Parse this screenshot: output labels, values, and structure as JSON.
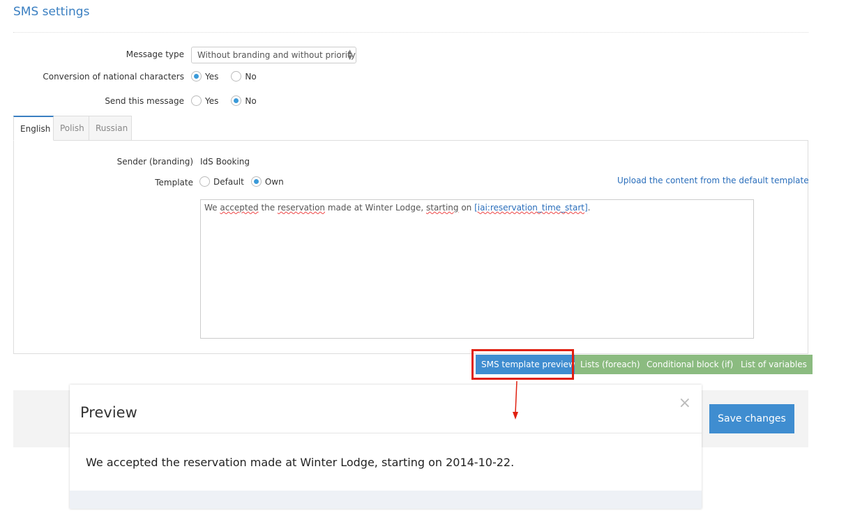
{
  "page": {
    "title": "SMS settings"
  },
  "form": {
    "message_type": {
      "label": "Message type",
      "value": "Without branding and without priority"
    },
    "conversion": {
      "label": "Conversion of national characters",
      "options": [
        "Yes",
        "No"
      ],
      "selected": "Yes"
    },
    "send": {
      "label": "Send this message",
      "options": [
        "Yes",
        "No"
      ],
      "selected": "No"
    }
  },
  "tabs": [
    {
      "label": "English",
      "active": true
    },
    {
      "label": "Polish"
    },
    {
      "label": "Russian"
    }
  ],
  "panel": {
    "sender_label": "Sender (branding)",
    "sender_value": "IdS Booking",
    "template_label": "Template",
    "template_options": [
      "Default",
      "Own"
    ],
    "template_selected": "Own",
    "upload_link": "Upload the content from the default template",
    "content": {
      "p1": "We ",
      "w1": "accepted",
      "p2": " the ",
      "w2": "reservation",
      "p3": " made at Winter Lodge, ",
      "w3": "starting",
      "p4": " on ",
      "w4": "[iai:reservation_time_start]",
      "p5": "."
    }
  },
  "buttons": {
    "preview": "SMS template preview",
    "foreach": "Lists (foreach)",
    "conditional": "Conditional block (if)",
    "variables": "List of variables",
    "save": "Save changes"
  },
  "modal": {
    "title": "Preview",
    "close": "×",
    "body": "We accepted the reservation made at Winter Lodge, starting on 2014-10-22."
  },
  "colors": {
    "accent": "#3a7fc1",
    "green": "#8bbb80",
    "highlight": "#e02010"
  }
}
